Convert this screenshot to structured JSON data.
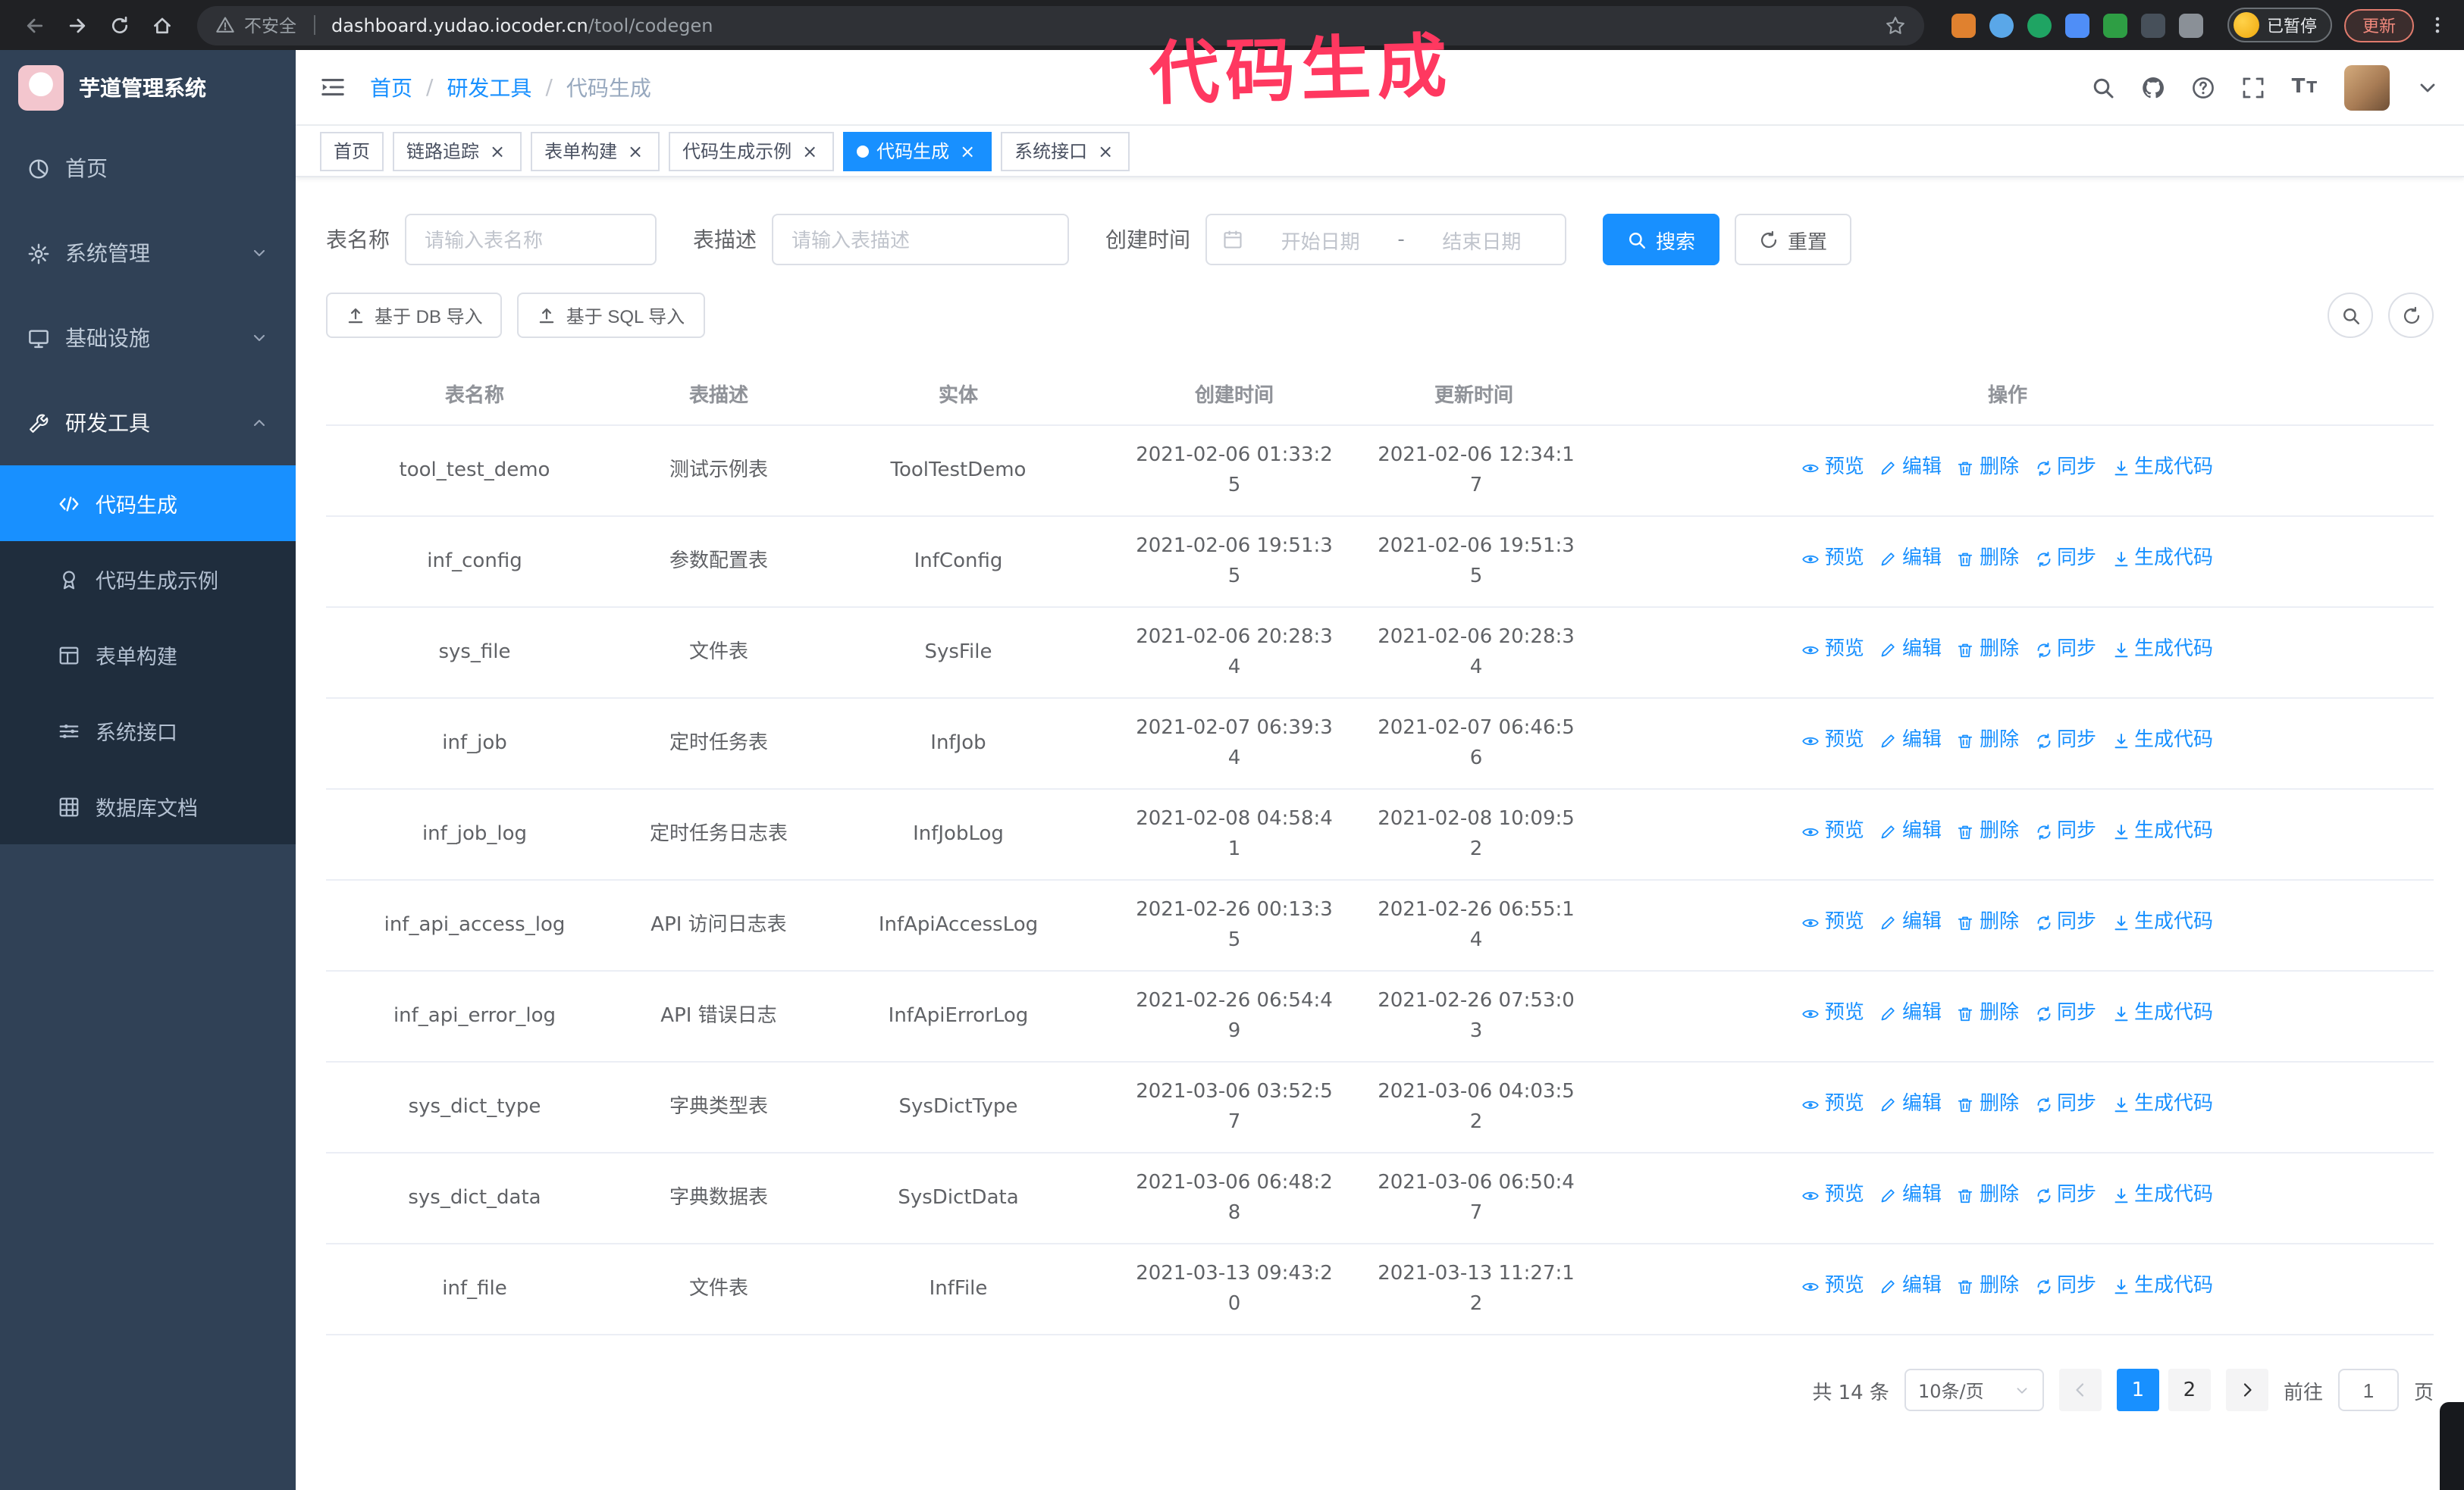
{
  "theme": {
    "accent": "#1890ff",
    "sidebar_bg": "#304156",
    "submenu_bg": "#1f2d3d",
    "tag_active_bg": "#1890ff",
    "annotation_color": "#ff3860"
  },
  "annotation": {
    "text": "代码生成"
  },
  "browser": {
    "security_chip": "不安全",
    "url_host": "dashboard.yudao.iocoder.cn",
    "url_path": "/tool/codegen",
    "paused_badge": "已暂停",
    "update_button": "更新",
    "extensions": [
      {
        "name": "ext-orange-icon",
        "color": "#e0812f",
        "shape": "square"
      },
      {
        "name": "ext-drop-icon",
        "color": "#5aa7e8",
        "shape": "circle"
      },
      {
        "name": "ext-green-check-icon",
        "color": "#1fa463",
        "shape": "circle"
      },
      {
        "name": "ext-people-icon",
        "color": "#4f8ef7",
        "shape": "square"
      },
      {
        "name": "ext-translate-icon",
        "color": "#2e9e44",
        "shape": "square"
      },
      {
        "name": "ext-dark-icon",
        "color": "#47505a",
        "shape": "square"
      },
      {
        "name": "ext-puzzle-icon",
        "color": "#8a9097",
        "shape": "square"
      }
    ]
  },
  "sidebar": {
    "app_title": "芋道管理系统",
    "items": [
      {
        "key": "home",
        "label": "首页",
        "icon": "dashboard"
      },
      {
        "key": "system",
        "label": "系统管理",
        "icon": "gear",
        "expandable": true
      },
      {
        "key": "infra",
        "label": "基础设施",
        "icon": "monitor",
        "expandable": true
      },
      {
        "key": "devtools",
        "label": "研发工具",
        "icon": "tools",
        "expandable": true,
        "expanded": true,
        "children": [
          {
            "key": "codegen",
            "label": "代码生成",
            "icon": "code",
            "active": true
          },
          {
            "key": "codegen-example",
            "label": "代码生成示例",
            "icon": "badge"
          },
          {
            "key": "form-builder",
            "label": "表单构建",
            "icon": "form"
          },
          {
            "key": "api",
            "label": "系统接口",
            "icon": "sliders"
          },
          {
            "key": "db-doc",
            "label": "数据库文档",
            "icon": "grid"
          }
        ]
      }
    ]
  },
  "header": {
    "breadcrumb": [
      "首页",
      "研发工具",
      "代码生成"
    ],
    "separator": "/"
  },
  "tabs": [
    {
      "label": "首页",
      "closable": false,
      "active": false
    },
    {
      "label": "链路追踪",
      "closable": true,
      "active": false
    },
    {
      "label": "表单构建",
      "closable": true,
      "active": false
    },
    {
      "label": "代码生成示例",
      "closable": true,
      "active": false
    },
    {
      "label": "代码生成",
      "closable": true,
      "active": true
    },
    {
      "label": "系统接口",
      "closable": true,
      "active": false
    }
  ],
  "filters": {
    "table_name_label": "表名称",
    "table_name_placeholder": "请输入表名称",
    "table_desc_label": "表描述",
    "table_desc_placeholder": "请输入表描述",
    "create_time_label": "创建时间",
    "date_start_placeholder": "开始日期",
    "date_separator": "-",
    "date_end_placeholder": "结束日期",
    "search_button": "搜索",
    "reset_button": "重置"
  },
  "toolbar": {
    "import_db": "基于 DB 导入",
    "import_sql": "基于 SQL 导入"
  },
  "table": {
    "columns": [
      "表名称",
      "表描述",
      "实体",
      "创建时间",
      "更新时间",
      "操作"
    ],
    "action_labels": [
      "预览",
      "编辑",
      "删除",
      "同步",
      "生成代码"
    ],
    "rows": [
      {
        "name": "tool_test_demo",
        "desc": "测试示例表",
        "entity": "ToolTestDemo",
        "created": "2021-02-06 01:33:25",
        "updated": "2021-02-06 12:34:17"
      },
      {
        "name": "inf_config",
        "desc": "参数配置表",
        "entity": "InfConfig",
        "created": "2021-02-06 19:51:35",
        "updated": "2021-02-06 19:51:35"
      },
      {
        "name": "sys_file",
        "desc": "文件表",
        "entity": "SysFile",
        "created": "2021-02-06 20:28:34",
        "updated": "2021-02-06 20:28:34"
      },
      {
        "name": "inf_job",
        "desc": "定时任务表",
        "entity": "InfJob",
        "created": "2021-02-07 06:39:34",
        "updated": "2021-02-07 06:46:56"
      },
      {
        "name": "inf_job_log",
        "desc": "定时任务日志表",
        "entity": "InfJobLog",
        "created": "2021-02-08 04:58:41",
        "updated": "2021-02-08 10:09:52"
      },
      {
        "name": "inf_api_access_log",
        "desc": "API 访问日志表",
        "entity": "InfApiAccessLog",
        "created": "2021-02-26 00:13:35",
        "updated": "2021-02-26 06:55:14"
      },
      {
        "name": "inf_api_error_log",
        "desc": "API 错误日志",
        "entity": "InfApiErrorLog",
        "created": "2021-02-26 06:54:49",
        "updated": "2021-02-26 07:53:03"
      },
      {
        "name": "sys_dict_type",
        "desc": "字典类型表",
        "entity": "SysDictType",
        "created": "2021-03-06 03:52:57",
        "updated": "2021-03-06 04:03:52"
      },
      {
        "name": "sys_dict_data",
        "desc": "字典数据表",
        "entity": "SysDictData",
        "created": "2021-03-06 06:48:28",
        "updated": "2021-03-06 06:50:47"
      },
      {
        "name": "inf_file",
        "desc": "文件表",
        "entity": "InfFile",
        "created": "2021-03-13 09:43:20",
        "updated": "2021-03-13 11:27:12"
      }
    ]
  },
  "pagination": {
    "total": "共 14 条",
    "page_size": "10条/页",
    "pages": [
      "1",
      "2"
    ],
    "active_page": "1",
    "prev_disabled": true,
    "goto_label": "前往",
    "goto_value": "1",
    "goto_suffix": "页"
  }
}
